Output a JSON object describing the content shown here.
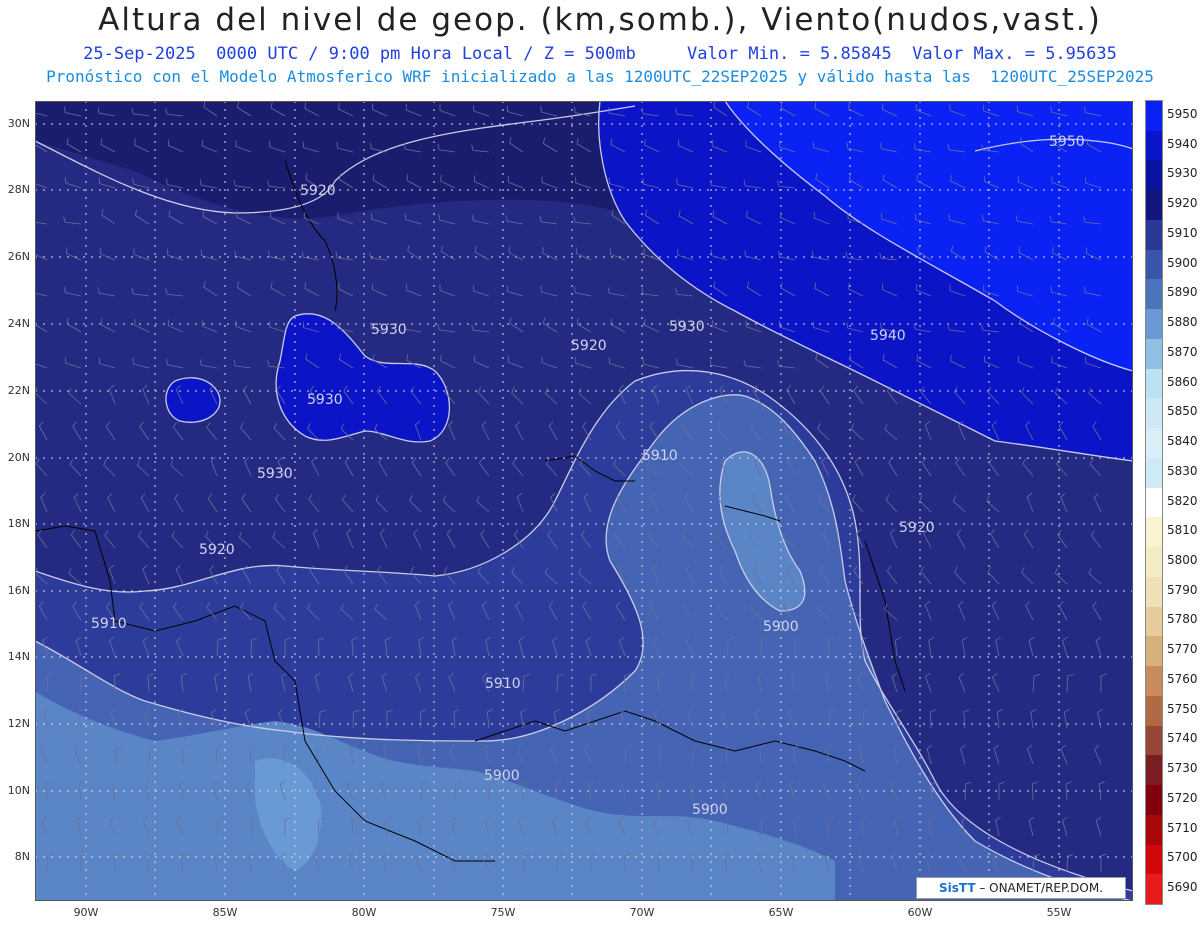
{
  "header": {
    "title": "Altura del nivel de geop. (km,somb.), Viento(nudos,vast.)",
    "subtitle": "25-Sep-2025  0000 UTC / 9:00 pm Hora Local / Z = 500mb     Valor Min. = 5.85845  Valor Max. = 5.95635",
    "subtitle2": "Pronóstico con el Modelo Atmosferico WRF inicializado a las 1200UTC_22SEP2025 y válido hasta las  1200UTC_25SEP2025"
  },
  "map": {
    "lat_labels": [
      "30N",
      "28N",
      "26N",
      "24N",
      "22N",
      "20N",
      "18N",
      "16N",
      "14N",
      "12N",
      "10N",
      "8N"
    ],
    "lon_labels": [
      "90W",
      "85W",
      "80W",
      "75W",
      "70W",
      "65W",
      "60W",
      "55W"
    ],
    "contour_labels": [
      "5950",
      "5920",
      "5930",
      "5940",
      "5930",
      "5920",
      "5930",
      "5930",
      "5910",
      "5920",
      "5920",
      "5910",
      "5900",
      "5910",
      "5900",
      "5900"
    ],
    "colors": {
      "c5900": "#4565b4",
      "c5910": "#2d3c9a",
      "c5920": "#242a82",
      "c5930": "#1a1c6e",
      "c5940": "#0b14c6",
      "c5950": "#0a22f4",
      "c5890": "#5a86c8",
      "c5880": "#6a9ad6",
      "contour": "#c8cce6",
      "coast": "#000000",
      "grid": "#dddddd"
    }
  },
  "colorbar": {
    "labels": [
      "5950",
      "5940",
      "5930",
      "5920",
      "5910",
      "5900",
      "5890",
      "5880",
      "5870",
      "5860",
      "5850",
      "5840",
      "5830",
      "5820",
      "5810",
      "5800",
      "5790",
      "5780",
      "5770",
      "5760",
      "5750",
      "5740",
      "5730",
      "5720",
      "5710",
      "5700",
      "5690"
    ],
    "colors": [
      "#0a22f4",
      "#0a14c8",
      "#0c12a0",
      "#14147e",
      "#2c3896",
      "#3a56a8",
      "#4a74bc",
      "#6a9ad6",
      "#8ec0e6",
      "#bce2f2",
      "#cfe8f6",
      "#daeef8",
      "#cdeaf5",
      "#ffffff",
      "#fbf3cf",
      "#f5ebc6",
      "#efe0b6",
      "#e6cc9a",
      "#d8b07a",
      "#c88c5a",
      "#b06a44",
      "#964634",
      "#7a1e24",
      "#800010",
      "#a80808",
      "#d00808",
      "#e81a1a"
    ]
  },
  "credit": {
    "brand": "SisTT",
    "text": " – ONAMET/REP.DOM."
  }
}
